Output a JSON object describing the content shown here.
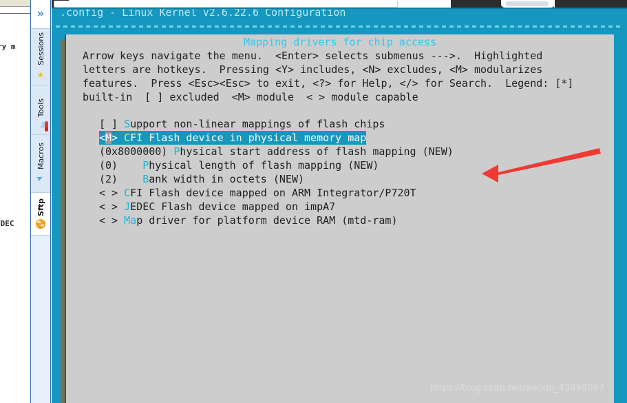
{
  "background_app": {
    "text_fragment_top": "ry m",
    "text_fragment_bottom": "EDEC"
  },
  "sidebar": {
    "expand_icon": "chevron-double-right",
    "tabs": [
      {
        "label": "Sessions",
        "icon": "star-icon",
        "active": false
      },
      {
        "label": "Tools",
        "icon": "tools-icon",
        "active": false
      },
      {
        "label": "Macros",
        "icon": "paper-plane-icon",
        "active": false
      },
      {
        "label": "Sftp",
        "icon": "globe-icon",
        "active": true
      }
    ]
  },
  "terminal": {
    "title": ".config - Linux Kernel v2.6.22.6 Configuration",
    "menu_heading": "Mapping drivers for chip access",
    "help_lines": [
      "Arrow keys navigate the menu.  <Enter> selects submenus --->.  Highlighted",
      "letters are hotkeys.  Pressing <Y> includes, <N> excludes, <M> modularizes",
      "features.  Press <Esc><Esc> to exit, <?> for Help, </> for Search.  Legend: [*]",
      "built-in  [ ] excluded  <M> module  < > module capable"
    ],
    "menu_items": [
      {
        "tag": "[ ] ",
        "hotkey": "S",
        "pre": "",
        "rest": "upport non-linear mappings of flash chips",
        "selected": false
      },
      {
        "tag": "<M> ",
        "cursor_char": "M",
        "hotkey": "C",
        "pre": "",
        "rest": "FI Flash device in physical memory map",
        "selected": true
      },
      {
        "tag": "(0x8000000) ",
        "hotkey": "P",
        "pre": "",
        "rest": "hysical start address of flash mapping (NEW)",
        "selected": false
      },
      {
        "tag": "(0)    ",
        "hotkey": "P",
        "pre": "",
        "rest": "hysical length of flash mapping (NEW)",
        "selected": false
      },
      {
        "tag": "(2)    ",
        "hotkey": "B",
        "pre": "",
        "rest": "ank width in octets (NEW)",
        "selected": false
      },
      {
        "tag": "< > ",
        "hotkey": "C",
        "pre": "",
        "rest": "FI Flash device mapped on ARM Integrator/P720T",
        "selected": false
      },
      {
        "tag": "< > ",
        "hotkey": "J",
        "pre": "",
        "rest": "EDEC Flash device mapped on impA7",
        "selected": false
      },
      {
        "tag": "< > ",
        "hotkey": "Ma",
        "pre": "",
        "rest": "p driver for platform device RAM (mtd-ram)",
        "selected": false
      }
    ]
  },
  "annotation": {
    "arrow_color": "#f03a34",
    "points_to": "CFI Flash device in physical memory map"
  },
  "watermark": "https://blog.csdn.net/weixin_43898067",
  "colors": {
    "terminal_bg": "#1597bf",
    "dialog_bg": "#cdcdcd",
    "title_text": "#bfe9f5",
    "heading_text": "#2fc8ef",
    "hotkey": "#17b6e0",
    "hotkey_selected": "#f2f24a",
    "sidebar_bg": "#dbe9f7"
  }
}
